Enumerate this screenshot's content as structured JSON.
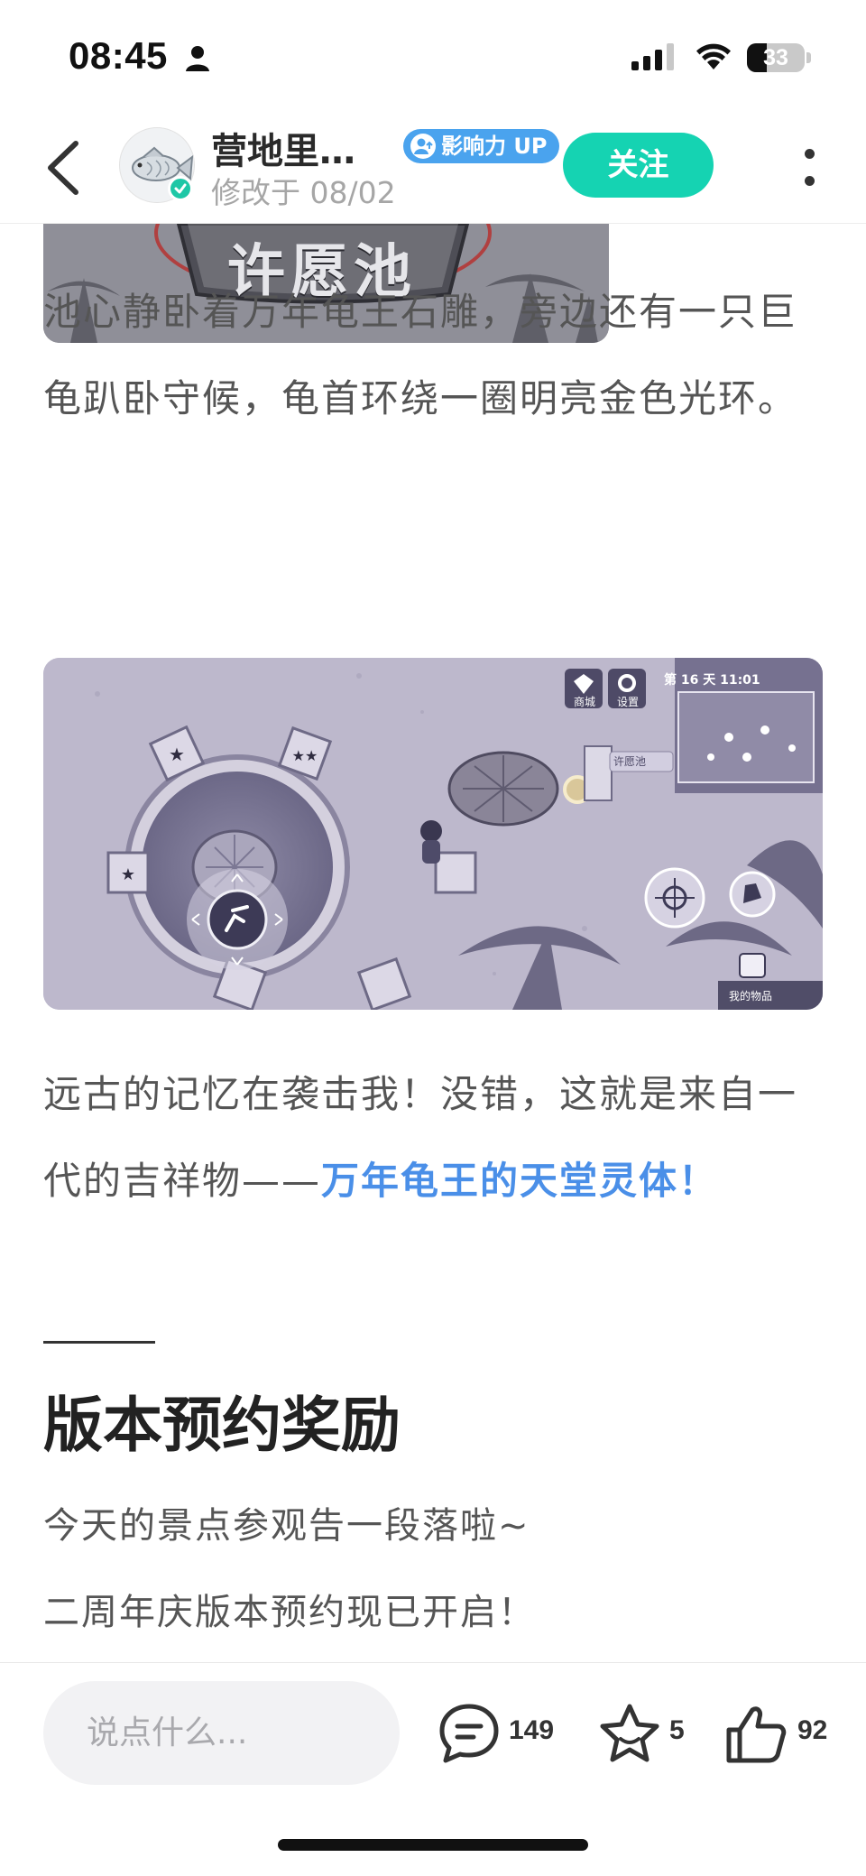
{
  "status_bar": {
    "time": "08:45",
    "battery": "33"
  },
  "header": {
    "author": "营地里…",
    "modified": "修改于 08/02",
    "influence_badge": "影响力 UP",
    "follow_label": "关注"
  },
  "content": {
    "image1_caption": "许愿池",
    "paragraph1": "池心静卧着万年龟王石雕，旁边还有一只巨龟趴卧守候，龟首环绕一圈明亮金色光环。",
    "game_hud": {
      "shop": "商城",
      "settings": "设置",
      "day_time": "第 16 天  11:01",
      "marker": "许愿池",
      "inventory": "我的物品"
    },
    "paragraph2_text": "远古的记忆在袭击我！没错，这就是来自一代的吉祥物——",
    "paragraph2_highlight": "万年龟王的天堂灵体！",
    "section_title": "版本预约奖励",
    "line1": "今天的景点参观告一段落啦~",
    "line2": "二周年庆版本预约现已开启！"
  },
  "bottom_bar": {
    "comment_placeholder": "说点什么...",
    "comments_count": "149",
    "favorites_count": "5",
    "likes_count": "92"
  },
  "colors": {
    "accent": "#15d3b2",
    "link": "#4a8fe8",
    "badge": "#4aa3ee"
  }
}
